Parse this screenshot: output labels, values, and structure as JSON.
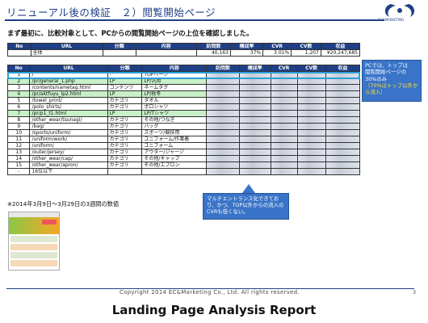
{
  "slide": {
    "title": "リニューアル後の検証　２）閲覧開始ページ",
    "logo_text": "EC&MARKETING",
    "intro": "まず最初に、比較対象として、PCからの閲覧開始ページの上位を確認しました。",
    "page_number": "3",
    "copyright": "Copyright  2014  EC&Marketing Co., Ltd.  All rights reserved."
  },
  "summary_table": {
    "headers": [
      "No",
      "URL",
      "分類",
      "内容",
      "訪問数",
      "構成率",
      "CVR",
      "CV数",
      "収益"
    ],
    "row": [
      "",
      "全体",
      "",
      "",
      "40,163",
      "37%",
      "3.01%",
      "1,207",
      "¥20,247,685"
    ]
  },
  "main_table": {
    "headers": [
      "No",
      "URL",
      "分類",
      "内容",
      "訪問数",
      "構成率",
      "CVR",
      "CV数",
      "収益"
    ],
    "rows": [
      [
        "1",
        "/",
        "-",
        "TOPページ"
      ],
      [
        "2",
        "/pr/general_1.php",
        "LP",
        "LP/汎用"
      ],
      [
        "3",
        "/contents/nametag.html",
        "コンテンツ",
        "ネームタグ"
      ],
      [
        "4",
        "/pr/aktfuyu_lp2.html",
        "LP",
        "LP/秋冬"
      ],
      [
        "5",
        "/towel_print/",
        "カテゴリ",
        "タオル"
      ],
      [
        "6",
        "/polo_shirts/",
        "カテゴリ",
        "ポロシャツ"
      ],
      [
        "7",
        "/pr/p1_t1.html",
        "LP",
        "LP/Tシャツ"
      ],
      [
        "8",
        "/other_wear/tsunagi/",
        "カテゴリ",
        "その他/つなぎ"
      ],
      [
        "9",
        "/bag/",
        "カテゴリ",
        "バッグ"
      ],
      [
        "10",
        "/sports/uniform/",
        "カテゴリ",
        "スポーツ/競技用"
      ],
      [
        "11",
        "/uniform/work/",
        "カテゴリ",
        "ユニフォーム/作業着"
      ],
      [
        "12",
        "/uniform/",
        "カテゴリ",
        "ユニフォーム"
      ],
      [
        "13",
        "/outer/jersey/",
        "カテゴリ",
        "アウター/ジャージ"
      ],
      [
        "14",
        "/other_wear/cap/",
        "カテゴリ",
        "その他/キャップ"
      ],
      [
        "15",
        "/other_wear/apron/",
        "カテゴリ",
        "その他/エプロン"
      ],
      [
        "-",
        "16位以下",
        "",
        ""
      ]
    ]
  },
  "callouts": {
    "first_lines": [
      "PCでは、トップは",
      "閲覧開始ページの",
      "30%のみ"
    ],
    "first_note": "（70%はトップ以外から流入）",
    "second": "マルチエントランス化できており、かつ、TOP以外からの流入のCVRも低くない。"
  },
  "note": "※2014年3月9日～3月29日の3週間の数値",
  "report_title": "Landing Page Analysis Report",
  "colors": {
    "brand": "#1f3f86",
    "callout": "#3a74c8",
    "highlight_row": "#c8f0c8"
  }
}
